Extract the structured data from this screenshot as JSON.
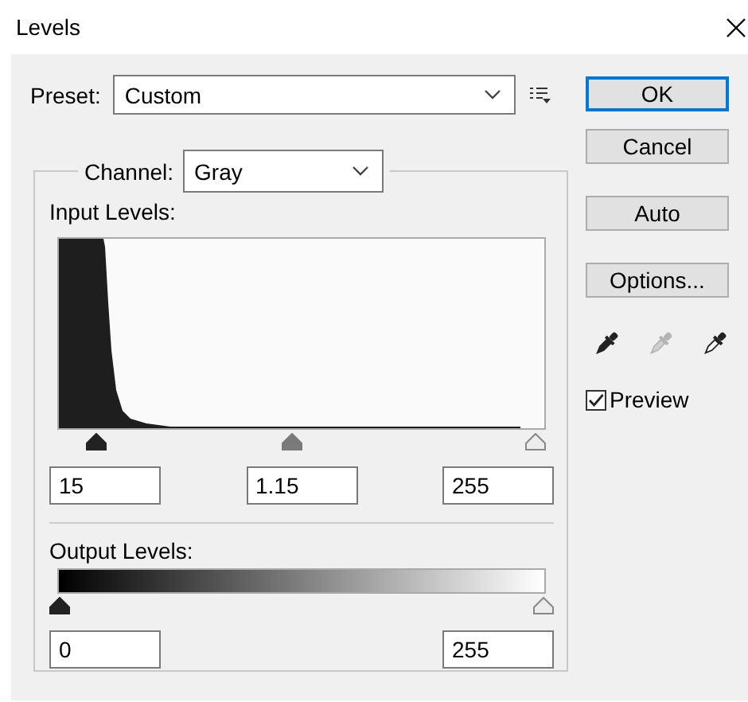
{
  "window": {
    "title": "Levels"
  },
  "preset": {
    "label": "Preset:",
    "value": "Custom"
  },
  "channel": {
    "label": "Channel:",
    "value": "Gray"
  },
  "input_levels": {
    "label": "Input Levels:",
    "thumbs": [
      {
        "kind": "black",
        "level": 0.062
      },
      {
        "kind": "gray",
        "level": 0.48
      },
      {
        "kind": "white",
        "level": 1
      }
    ],
    "fields": [
      "15",
      "1.15",
      "255"
    ]
  },
  "output_levels": {
    "label": "Output Levels:",
    "thumbs": [
      {
        "kind": "black",
        "level": 0
      },
      {
        "kind": "white",
        "level": 1
      }
    ],
    "fields": [
      "0",
      "255"
    ]
  },
  "buttons": [
    {
      "label": "OK",
      "default": true
    },
    {
      "label": "Cancel",
      "default": false
    },
    {
      "label": "Auto",
      "default": false
    },
    {
      "label": "Options...",
      "default": false
    }
  ],
  "eyedroppers": [
    {
      "kind": "black",
      "disabled": false
    },
    {
      "kind": "gray",
      "disabled": true
    },
    {
      "kind": "white",
      "disabled": false
    }
  ],
  "preview": {
    "label": "Preview",
    "checked": true
  }
}
